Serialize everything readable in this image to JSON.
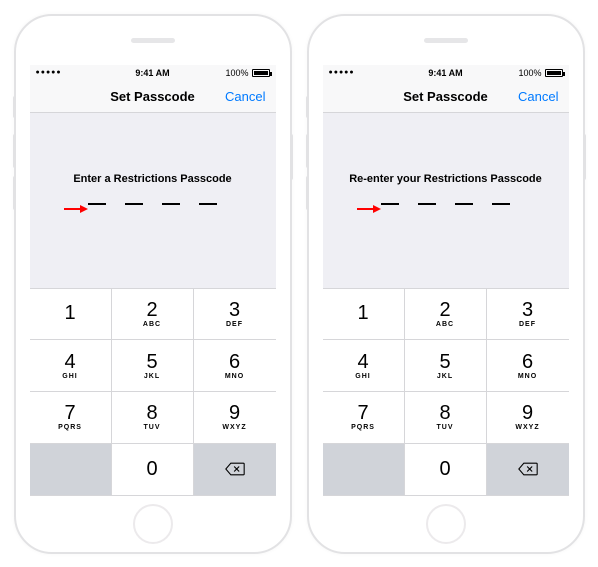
{
  "phones": [
    {
      "status": {
        "time": "9:41 AM",
        "battery_pct": "100%"
      },
      "nav": {
        "title": "Set Passcode",
        "cancel": "Cancel"
      },
      "prompt": "Enter a Restrictions Passcode"
    },
    {
      "status": {
        "time": "9:41 AM",
        "battery_pct": "100%"
      },
      "nav": {
        "title": "Set Passcode",
        "cancel": "Cancel"
      },
      "prompt": "Re-enter your Restrictions Passcode"
    }
  ],
  "keypad": [
    {
      "digit": "1",
      "letters": ""
    },
    {
      "digit": "2",
      "letters": "ABC"
    },
    {
      "digit": "3",
      "letters": "DEF"
    },
    {
      "digit": "4",
      "letters": "GHI"
    },
    {
      "digit": "5",
      "letters": "JKL"
    },
    {
      "digit": "6",
      "letters": "MNO"
    },
    {
      "digit": "7",
      "letters": "PQRS"
    },
    {
      "digit": "8",
      "letters": "TUV"
    },
    {
      "digit": "9",
      "letters": "WXYZ"
    }
  ],
  "zero": {
    "digit": "0",
    "letters": ""
  }
}
